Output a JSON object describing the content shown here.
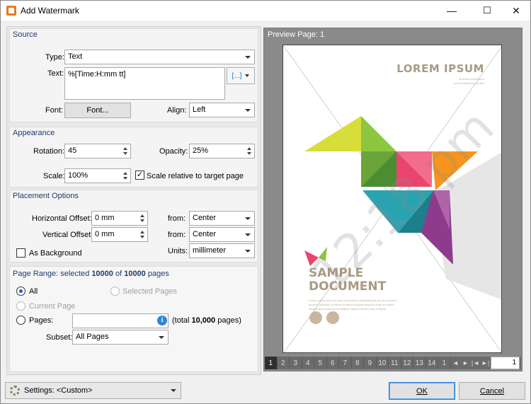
{
  "window": {
    "title": "Add Watermark",
    "minimize": "—",
    "maximize": "☐",
    "close": "✕"
  },
  "source": {
    "section_title": "Source",
    "type_label": "Type:",
    "type_value": "Text",
    "text_label": "Text:",
    "text_value": "%[Time:H:mm tt]",
    "macro_button": "[...]",
    "font_label": "Font:",
    "font_button": "Font...",
    "align_label": "Align:",
    "align_value": "Left"
  },
  "appearance": {
    "section_title": "Appearance",
    "rotation_label": "Rotation:",
    "rotation_value": "45",
    "opacity_label": "Opacity:",
    "opacity_value": "25%",
    "scale_label": "Scale:",
    "scale_value": "100%",
    "scale_relative_label": "Scale relative to target page",
    "scale_relative_checked": true
  },
  "placement": {
    "section_title": "Placement Options",
    "h_offset_label": "Horizontal Offset:",
    "h_offset_value": "0 mm",
    "v_offset_label": "Vertical Offset:",
    "v_offset_value": "0 mm",
    "h_from_label": "from:",
    "h_from_value": "Center",
    "v_from_label": "from:",
    "v_from_value": "Center",
    "as_background_label": "As Background",
    "units_label": "Units:",
    "units_value": "millimeter"
  },
  "page_range": {
    "title_prefix": "Page Range: selected ",
    "selected_count": "10000",
    "title_mid": " of ",
    "total_count": "10000",
    "title_suffix": " pages",
    "all_label": "All",
    "selected_pages_label": "Selected Pages",
    "current_page_label": "Current Page",
    "pages_label": "Pages:",
    "pages_value": "",
    "total_text_prefix": "(total ",
    "total_text_count": "10,000",
    "total_text_suffix": " pages)",
    "subset_label": "Subset:",
    "subset_value": "All Pages"
  },
  "preview": {
    "title": "Preview Page: 1",
    "doc_heading": "LOREM IPSUM",
    "doc_sub1": "sit amet consectetur",
    "doc_sub2": "lorem adipiscing elit sed",
    "sample_line1": "SAMPLE",
    "sample_line2": "DOCUMENT",
    "body1": "Lorem ipsum dolor sit amet consectetur adipiscing elit sed do eiusmod",
    "body2": "tempor incididunt ut labore et dolore magna aliqua ut enim ad minim",
    "body3": "veniam quis nostrud exercitation ullamco laboris nisi ut aliquip",
    "watermark_text": "12:18 pm",
    "pages": [
      "1",
      "2",
      "3",
      "4",
      "5",
      "6",
      "7",
      "8",
      "9",
      "10",
      "11",
      "12",
      "13",
      "14",
      "1"
    ],
    "page_input": "1"
  },
  "footer": {
    "settings_label": "Settings: <Custom>",
    "ok": "OK",
    "cancel": "Cancel"
  },
  "colors": {
    "accent": "#1f5fbf",
    "preview_bg": "#808080",
    "origami_green": "#8dc63f",
    "origami_orange": "#f7941d",
    "origami_pink": "#e8466f",
    "origami_teal": "#2aa3b0",
    "origami_purple": "#8e3b8e"
  }
}
